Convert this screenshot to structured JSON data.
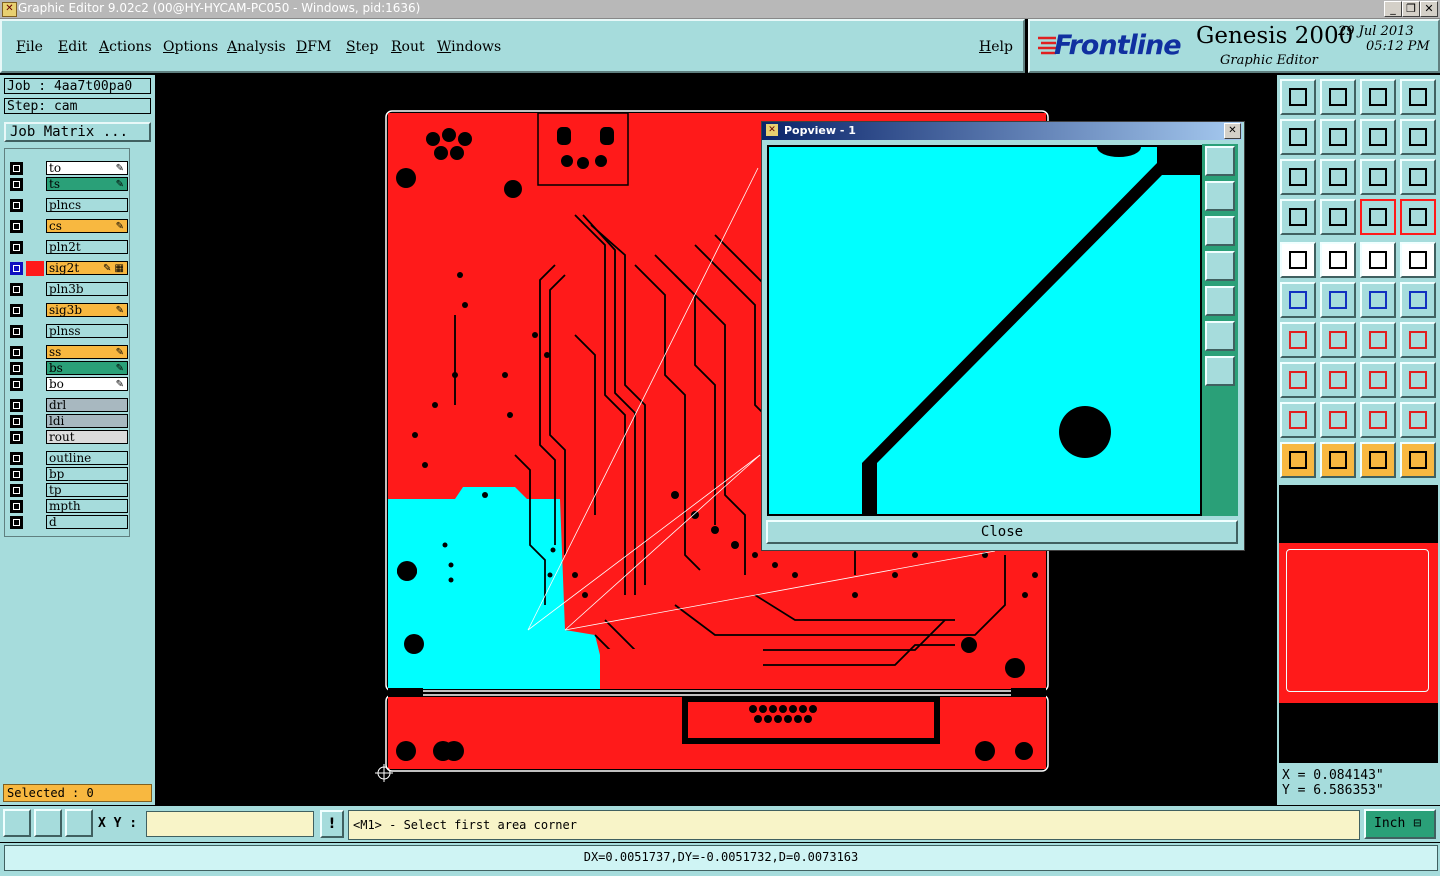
{
  "window": {
    "title": "Graphic Editor 9.02c2 (00@HY-HYCAM-PC050 - Windows, pid:1636)"
  },
  "menu": [
    {
      "label": "File",
      "key": "F"
    },
    {
      "label": "Edit",
      "key": "E"
    },
    {
      "label": "Actions",
      "key": "A"
    },
    {
      "label": "Options",
      "key": "O"
    },
    {
      "label": "Analysis",
      "key": "A"
    },
    {
      "label": "DFM",
      "key": "D"
    },
    {
      "label": "Step",
      "key": "S"
    },
    {
      "label": "Rout",
      "key": "R"
    },
    {
      "label": "Windows",
      "key": "W"
    },
    {
      "label": "Help",
      "key": "H"
    }
  ],
  "brand": {
    "logo": "Frontline",
    "product": "Genesis 2000",
    "subtitle": "Graphic Editor",
    "date": "29 Jul 2013",
    "time": "05:12 PM"
  },
  "job": {
    "job_label": "Job : 4aa7t00pa0",
    "step_label": "Step: cam",
    "matrix_button": "Job Matrix ..."
  },
  "layers": [
    {
      "name": "to",
      "color": "#ffffff",
      "mark": "✎"
    },
    {
      "name": "ts",
      "color": "#2aa078",
      "mark": "✎"
    },
    {
      "name": "plncs",
      "color": "#a6dcdc",
      "mark": ""
    },
    {
      "name": "cs",
      "color": "#f8b840",
      "mark": "✎"
    },
    {
      "name": "pln2t",
      "color": "#a6dcdc",
      "mark": ""
    },
    {
      "name": "sig2t",
      "color": "#f8b840",
      "mark": "✎ ▦",
      "active": true
    },
    {
      "name": "pln3b",
      "color": "#a6dcdc",
      "mark": ""
    },
    {
      "name": "sig3b",
      "color": "#f8b840",
      "mark": "✎"
    },
    {
      "name": "plnss",
      "color": "#a6dcdc",
      "mark": ""
    },
    {
      "name": "ss",
      "color": "#f8b840",
      "mark": "✎"
    },
    {
      "name": "bs",
      "color": "#2aa078",
      "mark": "✎"
    },
    {
      "name": "bo",
      "color": "#ffffff",
      "mark": "✎"
    },
    {
      "name": "drl",
      "color": "#a8b8c0",
      "mark": ""
    },
    {
      "name": "ldi",
      "color": "#a8b8c0",
      "mark": ""
    },
    {
      "name": "rout",
      "color": "#dcdcdc",
      "mark": ""
    },
    {
      "name": "outline",
      "color": "#a6dcdc",
      "mark": ""
    },
    {
      "name": "bp",
      "color": "#a6dcdc",
      "mark": ""
    },
    {
      "name": "tp",
      "color": "#a6dcdc",
      "mark": ""
    },
    {
      "name": "mpth",
      "color": "#a6dcdc",
      "mark": ""
    },
    {
      "name": "d",
      "color": "#a6dcdc",
      "mark": ""
    }
  ],
  "selected": "Selected : 0",
  "popview": {
    "title": "Popview - 1",
    "close_label": "Close"
  },
  "coords": {
    "x": "X = 0.084143\"",
    "y": "Y = 6.586353\""
  },
  "bottom": {
    "xy_label": "X Y :",
    "xy_value": "",
    "prompt": "<M1> - Select first area corner",
    "units": "Inch"
  },
  "status": {
    "text": "DX=0.0051737,DY=-0.0051732,D=0.0073163"
  },
  "colors": {
    "panel": "#a6dcdc",
    "board": "#ff1a1a",
    "cyan_layer": "#00ffff",
    "accent": "#f8b840"
  }
}
